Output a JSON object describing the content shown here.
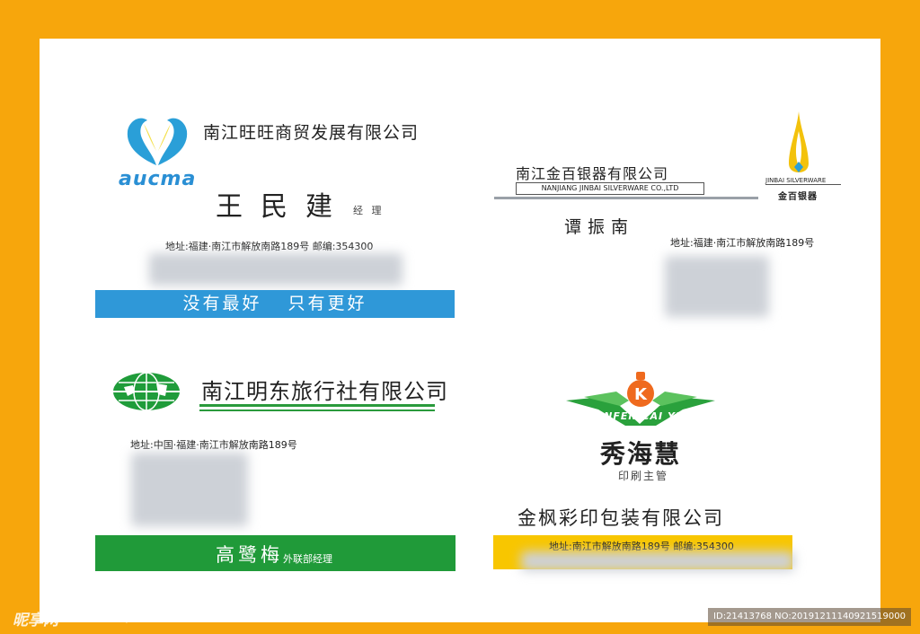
{
  "card1": {
    "logo_text": "aucma",
    "company": "南江旺旺商贸发展有限公司",
    "name": "王民建",
    "title": "经 理",
    "address": "地址:福建·南江市解放南路189号  邮编:354300",
    "slogan": "没有最好  只有更好"
  },
  "card2": {
    "company": "南江金百银器有限公司",
    "company_en": "NANJIANG JINBAI SILVERWARE CO.,LTD",
    "name": "谭振南",
    "address": "地址:福建·南江市解放南路189号",
    "logo_en": "JINBAI SILVERWARE",
    "logo_cn": "金百银器"
  },
  "card3": {
    "company": "南江明东旅行社有限公司",
    "address": "地址:中国·福建·南江市解放南路189号",
    "name": "高鹭梅",
    "title": "外联部经理"
  },
  "card4": {
    "logo_en": "JINFEN CAI YIN",
    "logo_letter": "K",
    "name": "秀海慧",
    "title": "印刷主管",
    "company": "金枫彩印包装有限公司",
    "address": "地址:南江市解放南路189号  邮编:354300"
  },
  "watermark": {
    "site": "昵享网",
    "url": "www.nipic.cn",
    "id_text": "ID:21413768 NO:20191211140921519000"
  },
  "colors": {
    "frame": "#f7a60c",
    "blue_bar": "#2f98d8",
    "green_bar": "#209a39",
    "yellow_bar": "#f8c600"
  }
}
